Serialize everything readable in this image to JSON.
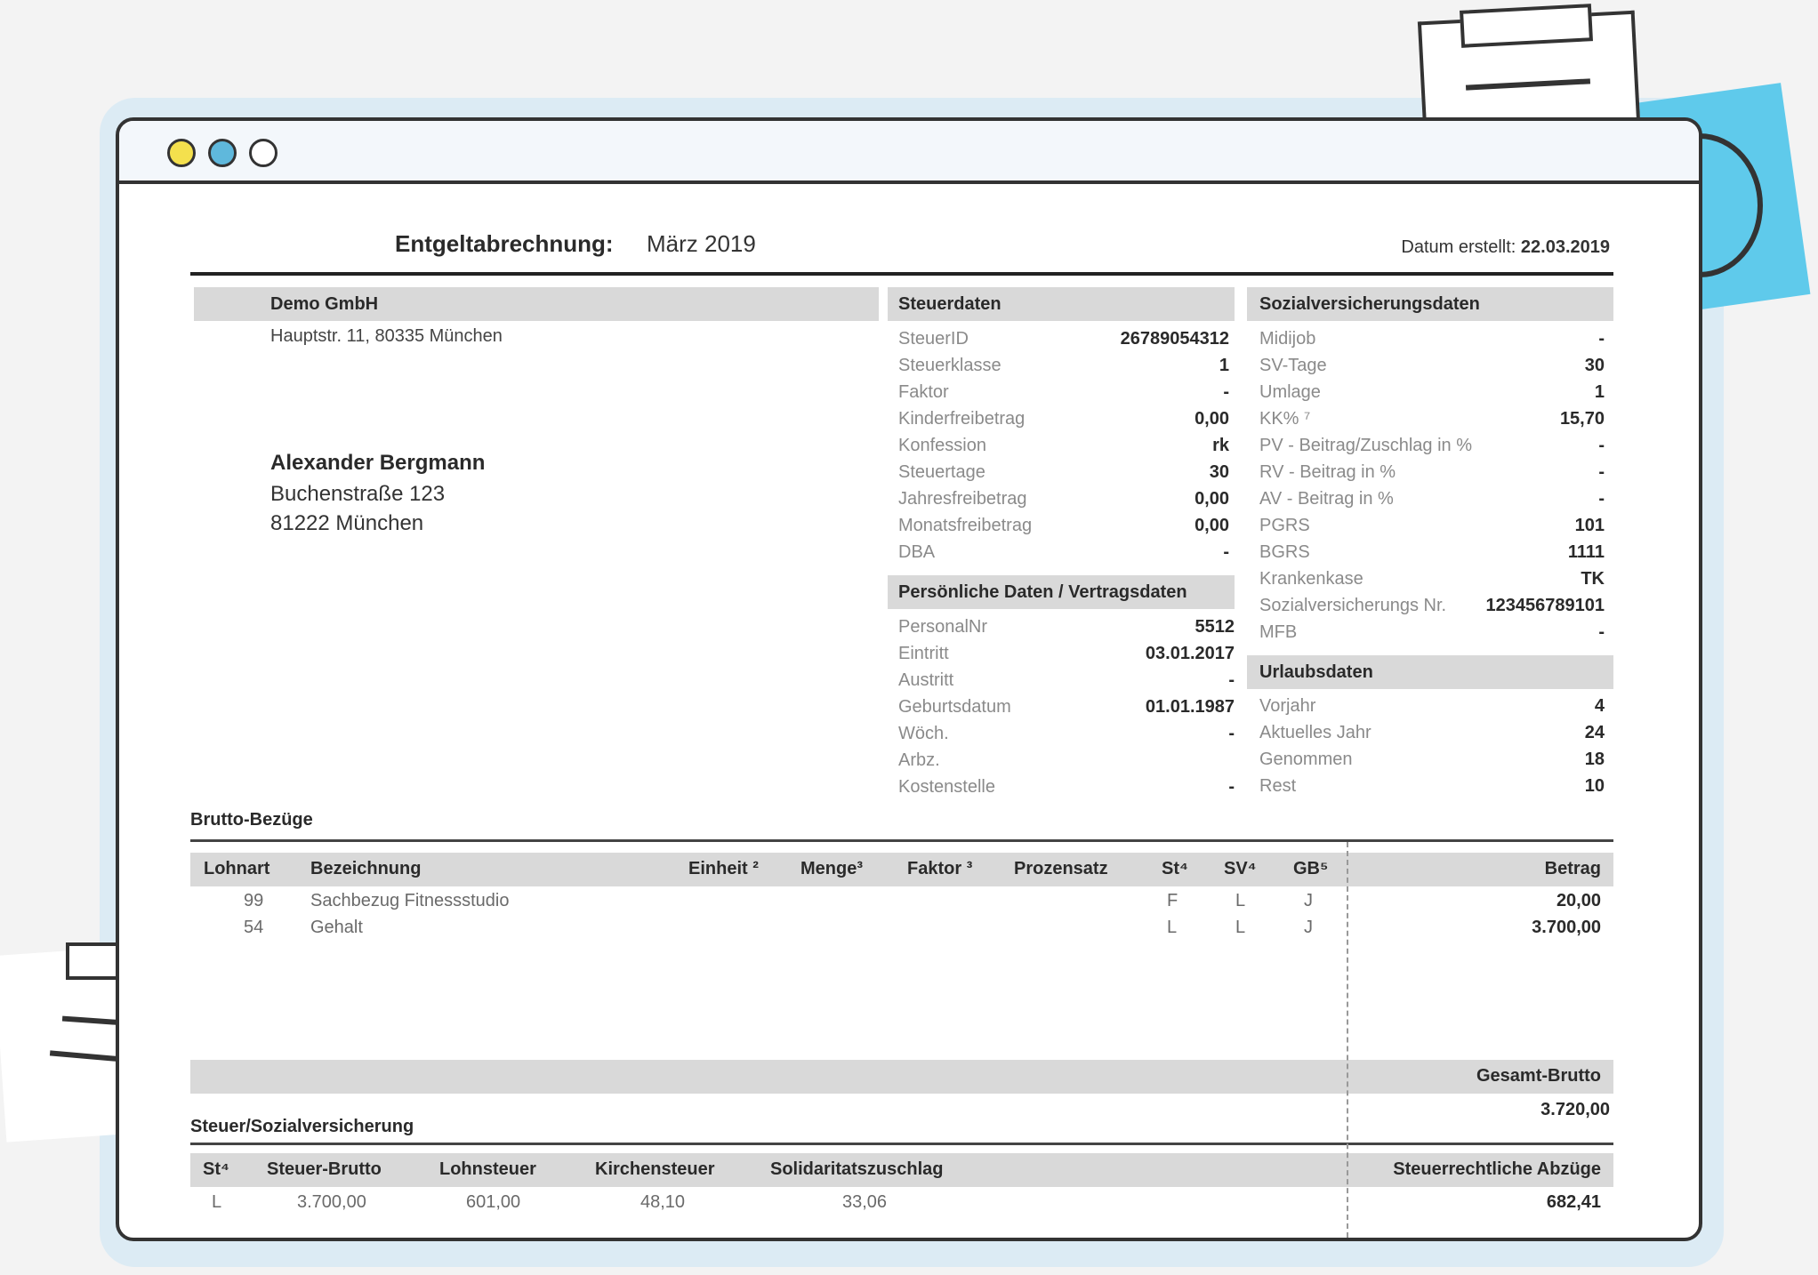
{
  "document": {
    "title": "Entgeltabrechnung:",
    "month": "März 2019",
    "date_label": "Datum erstellt:",
    "date_value": "22.03.2019"
  },
  "company": {
    "name": "Demo GmbH",
    "address": "Hauptstr. 11, 80335 München"
  },
  "employee": {
    "name": "Alexander Bergmann",
    "street": "Buchenstraße 123",
    "city": "81222 München"
  },
  "steuerdaten": {
    "heading": "Steuerdaten",
    "rows": [
      {
        "k": "SteuerID",
        "v": "26789054312"
      },
      {
        "k": "Steuerklasse",
        "v": "1"
      },
      {
        "k": "Faktor",
        "v": "-"
      },
      {
        "k": "Kinderfreibetrag",
        "v": "0,00"
      },
      {
        "k": "Konfession",
        "v": "rk"
      },
      {
        "k": "Steuertage",
        "v": "30"
      },
      {
        "k": "Jahresfreibetrag",
        "v": "0,00"
      },
      {
        "k": "Monatsfreibetrag",
        "v": "0,00"
      },
      {
        "k": "DBA",
        "v": "-"
      }
    ]
  },
  "persoenlich": {
    "heading": "Persönliche Daten / Vertragsdaten",
    "rows": [
      {
        "k": "PersonalNr",
        "v": "5512"
      },
      {
        "k": "Eintritt",
        "v": "03.01.2017"
      },
      {
        "k": "Austritt",
        "v": "-"
      },
      {
        "k": "Geburtsdatum",
        "v": "01.01.1987"
      },
      {
        "k": "Wöch.",
        "v": "-"
      },
      {
        "k": "Arbz.",
        "v": ""
      },
      {
        "k": "Kostenstelle",
        "v": "-"
      }
    ]
  },
  "sv": {
    "heading": "Sozialversicherungsdaten",
    "rows": [
      {
        "k": "Midijob",
        "v": "-"
      },
      {
        "k": "SV-Tage",
        "v": "30"
      },
      {
        "k": "Umlage",
        "v": "1"
      },
      {
        "k": "KK% ⁷",
        "v": "15,70"
      },
      {
        "k": "PV - Beitrag/Zuschlag in %",
        "v": "-"
      },
      {
        "k": "RV - Beitrag in %",
        "v": "-"
      },
      {
        "k": "AV - Beitrag in %",
        "v": "-"
      },
      {
        "k": "PGRS",
        "v": "101"
      },
      {
        "k": "BGRS",
        "v": "1111"
      },
      {
        "k": "Krankenkase",
        "v": "TK"
      },
      {
        "k": "Sozialversicherungs Nr.",
        "v": "123456789101"
      },
      {
        "k": "MFB",
        "v": "-"
      }
    ]
  },
  "urlaub": {
    "heading": "Urlaubsdaten",
    "rows": [
      {
        "k": "Vorjahr",
        "v": "4"
      },
      {
        "k": "Aktuelles Jahr",
        "v": "24"
      },
      {
        "k": "Genommen",
        "v": "18"
      },
      {
        "k": "Rest",
        "v": "10"
      }
    ]
  },
  "brutto": {
    "section_label": "Brutto-Bezüge",
    "columns": {
      "lohnart": "Lohnart",
      "bezeichnung": "Bezeichnung",
      "einheit": "Einheit ²",
      "menge": "Menge³",
      "faktor": "Faktor ³",
      "prozentsatz": "Prozensatz",
      "st": "St⁴",
      "sv": "SV⁴",
      "gb": "GB⁵",
      "betrag": "Betrag"
    },
    "rows": [
      {
        "lohnart": "99",
        "bezeichnung": "Sachbezug Fitnessstudio",
        "st": "F",
        "sv": "L",
        "gb": "J",
        "betrag": "20,00"
      },
      {
        "lohnart": "54",
        "bezeichnung": "Gehalt",
        "st": "L",
        "sv": "L",
        "gb": "J",
        "betrag": "3.700,00"
      }
    ],
    "total_label": "Gesamt-Brutto",
    "total_value": "3.720,00"
  },
  "steuer": {
    "section_label": "Steuer/Sozialversicherung",
    "columns": {
      "st": "St⁴",
      "steuer_brutto": "Steuer-Brutto",
      "lohnsteuer": "Lohnsteuer",
      "kirchensteuer": "Kirchensteuer",
      "soli": "Solidaritatszuschlag",
      "abzuege": "Steuerrechtliche Abzüge"
    },
    "row": {
      "st": "L",
      "steuer_brutto": "3.700,00",
      "lohnsteuer": "601,00",
      "kirchensteuer": "48,10",
      "soli": "33,06",
      "abzuege": "682,41"
    }
  },
  "colors": {
    "accent_blue": "#5fcaeb",
    "dot_yellow": "#f4e04d",
    "dot_blue": "#5fb8dc",
    "header_gray": "#d9d9d9"
  }
}
